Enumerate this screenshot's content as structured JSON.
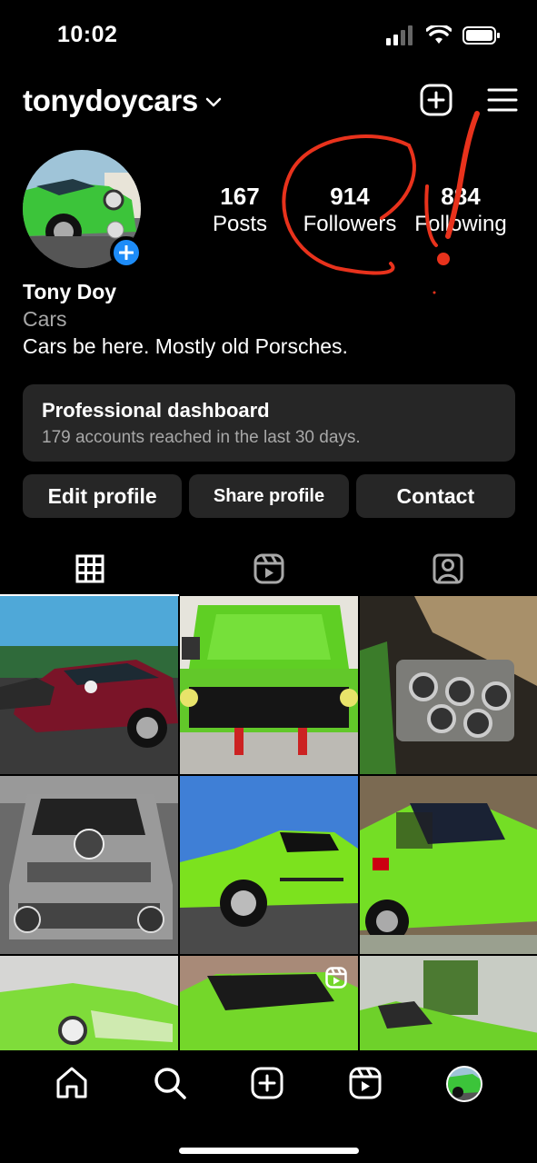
{
  "status_bar": {
    "time": "10:02"
  },
  "header": {
    "username": "tonydoycars"
  },
  "stats": [
    {
      "value": "167",
      "label": "Posts"
    },
    {
      "value": "914",
      "label": "Followers"
    },
    {
      "value": "884",
      "label": "Following"
    }
  ],
  "bio": {
    "name": "Tony Doy",
    "category": "Cars",
    "text": "Cars be here. Mostly old Porsches."
  },
  "dashboard": {
    "title": "Professional dashboard",
    "subtitle": "179 accounts reached in the last 30 days."
  },
  "buttons": {
    "edit": "Edit profile",
    "share": "Share profile",
    "contact": "Contact"
  },
  "tabs": [
    "grid-icon",
    "reels-icon",
    "tagged-icon"
  ],
  "grid_posts": [
    {
      "desc": "red-porsche-911"
    },
    {
      "desc": "green-914-engine-lid-open"
    },
    {
      "desc": "engine-carburetors"
    },
    {
      "desc": "jagermeister-race-car"
    },
    {
      "desc": "green-914-side"
    },
    {
      "desc": "green-914-black-top"
    },
    {
      "desc": "green-car-front"
    },
    {
      "desc": "green-914-reel"
    },
    {
      "desc": "green-car-garage"
    }
  ],
  "bottom_nav": [
    "home-icon",
    "search-icon",
    "create-icon",
    "reels-icon",
    "profile-avatar"
  ],
  "colors": {
    "background": "#000000",
    "card": "#262626",
    "accent_blue": "#1d8cf8",
    "annotation_red": "#e8321c",
    "secondary_text": "#a8a8a8"
  }
}
